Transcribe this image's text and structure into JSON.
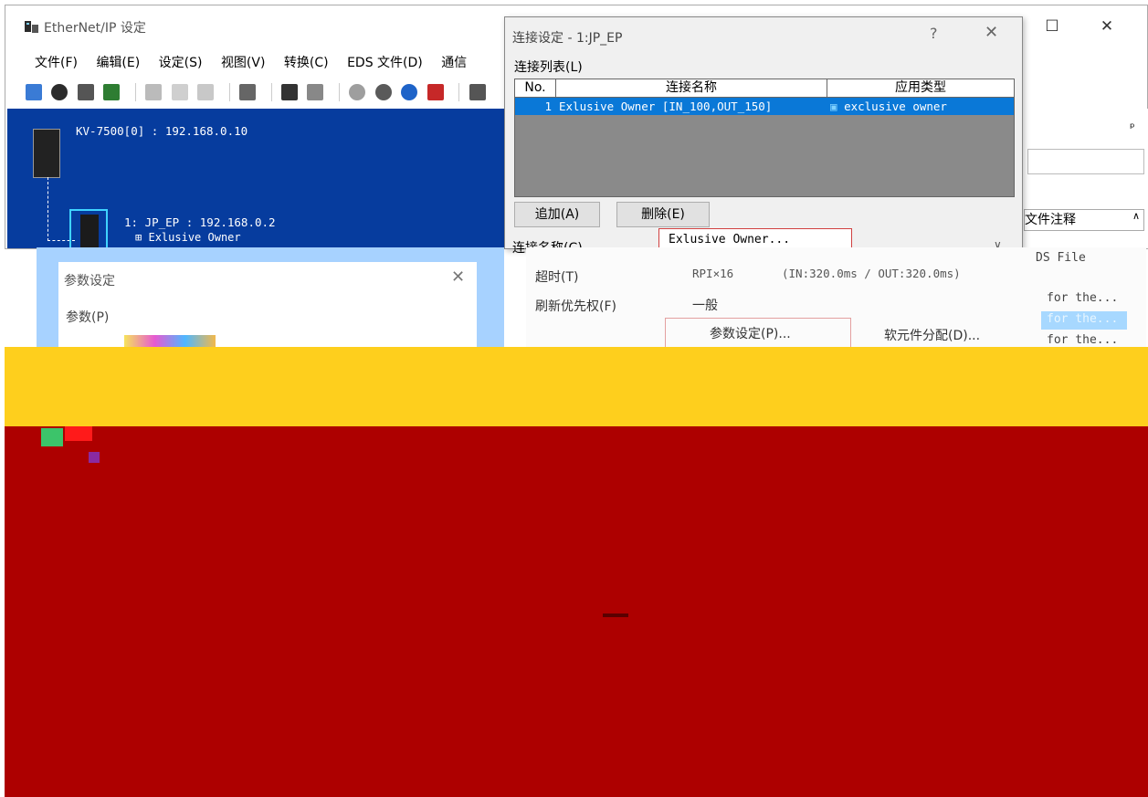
{
  "window": {
    "title": "EtherNet/IP 设定",
    "controls": {
      "minimize": "—",
      "maximize": "☐",
      "close": "✕"
    }
  },
  "menubar": [
    "文件(F)",
    "编辑(E)",
    "设定(S)",
    "视图(V)",
    "转换(C)",
    "EDS 文件(D)",
    "通信"
  ],
  "network": {
    "plc_label": "KV-7500[0] : 192.168.0.10",
    "node_label": "1: JP_EP : 192.168.0.2",
    "node_sub": "Exlusive Owner",
    "expand_glyph": "⊞"
  },
  "right_panel": {
    "pin": "ᵖ",
    "file_comment_header": "文件注释",
    "items": [
      "DS File",
      "for the...",
      "for the...",
      "for the..."
    ]
  },
  "connection_dialog": {
    "title": "连接设定 - 1:JP_EP",
    "help": "?",
    "close": "✕",
    "list_label": "连接列表(L)",
    "columns": [
      "No.",
      "连接名称",
      "应用类型"
    ],
    "rows": [
      {
        "no": "1",
        "name": "Exlusive Owner [IN_100,OUT_150]",
        "type": "exclusive owner"
      }
    ],
    "add_button": "追加(A)",
    "delete_button": "删除(E)",
    "name_label": "连接名称(C)",
    "name_value": "Exlusive Owner..."
  },
  "lower_fragment": {
    "timeout_label": "超时(T)",
    "timeout_value": "RPI×16",
    "timeout_info": "(IN:320.0ms / OUT:320.0ms)",
    "priority_label": "刷新优先权(F)",
    "priority_value": "一般",
    "param_button": "参数设定(P)...",
    "device_button": "软元件分配(D)..."
  },
  "param_dialog": {
    "title": "参数设定",
    "close": "✕",
    "param_label": "参数(P)"
  }
}
